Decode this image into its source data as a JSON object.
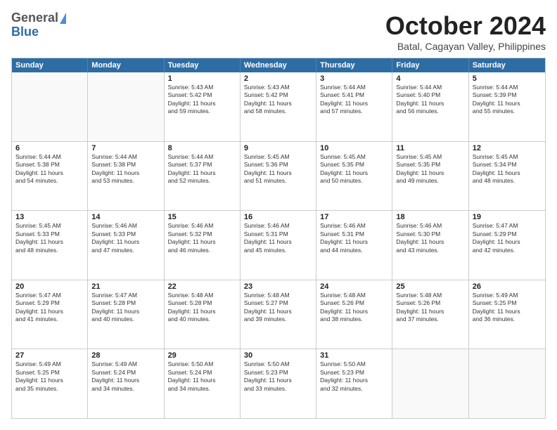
{
  "logo": {
    "general": "General",
    "blue": "Blue"
  },
  "header": {
    "month": "October 2024",
    "location": "Batal, Cagayan Valley, Philippines"
  },
  "weekdays": [
    "Sunday",
    "Monday",
    "Tuesday",
    "Wednesday",
    "Thursday",
    "Friday",
    "Saturday"
  ],
  "rows": [
    [
      {
        "day": "",
        "empty": true
      },
      {
        "day": "",
        "empty": true
      },
      {
        "day": "1",
        "sunrise": "5:43 AM",
        "sunset": "5:42 PM",
        "daylight": "11 hours and 59 minutes."
      },
      {
        "day": "2",
        "sunrise": "5:43 AM",
        "sunset": "5:42 PM",
        "daylight": "11 hours and 58 minutes."
      },
      {
        "day": "3",
        "sunrise": "5:44 AM",
        "sunset": "5:41 PM",
        "daylight": "11 hours and 57 minutes."
      },
      {
        "day": "4",
        "sunrise": "5:44 AM",
        "sunset": "5:40 PM",
        "daylight": "11 hours and 56 minutes."
      },
      {
        "day": "5",
        "sunrise": "5:44 AM",
        "sunset": "5:39 PM",
        "daylight": "11 hours and 55 minutes."
      }
    ],
    [
      {
        "day": "6",
        "sunrise": "5:44 AM",
        "sunset": "5:38 PM",
        "daylight": "11 hours and 54 minutes."
      },
      {
        "day": "7",
        "sunrise": "5:44 AM",
        "sunset": "5:38 PM",
        "daylight": "11 hours and 53 minutes."
      },
      {
        "day": "8",
        "sunrise": "5:44 AM",
        "sunset": "5:37 PM",
        "daylight": "11 hours and 52 minutes."
      },
      {
        "day": "9",
        "sunrise": "5:45 AM",
        "sunset": "5:36 PM",
        "daylight": "11 hours and 51 minutes."
      },
      {
        "day": "10",
        "sunrise": "5:45 AM",
        "sunset": "5:35 PM",
        "daylight": "11 hours and 50 minutes."
      },
      {
        "day": "11",
        "sunrise": "5:45 AM",
        "sunset": "5:35 PM",
        "daylight": "11 hours and 49 minutes."
      },
      {
        "day": "12",
        "sunrise": "5:45 AM",
        "sunset": "5:34 PM",
        "daylight": "11 hours and 48 minutes."
      }
    ],
    [
      {
        "day": "13",
        "sunrise": "5:45 AM",
        "sunset": "5:33 PM",
        "daylight": "11 hours and 48 minutes."
      },
      {
        "day": "14",
        "sunrise": "5:46 AM",
        "sunset": "5:33 PM",
        "daylight": "11 hours and 47 minutes."
      },
      {
        "day": "15",
        "sunrise": "5:46 AM",
        "sunset": "5:32 PM",
        "daylight": "11 hours and 46 minutes."
      },
      {
        "day": "16",
        "sunrise": "5:46 AM",
        "sunset": "5:31 PM",
        "daylight": "11 hours and 45 minutes."
      },
      {
        "day": "17",
        "sunrise": "5:46 AM",
        "sunset": "5:31 PM",
        "daylight": "11 hours and 44 minutes."
      },
      {
        "day": "18",
        "sunrise": "5:46 AM",
        "sunset": "5:30 PM",
        "daylight": "11 hours and 43 minutes."
      },
      {
        "day": "19",
        "sunrise": "5:47 AM",
        "sunset": "5:29 PM",
        "daylight": "11 hours and 42 minutes."
      }
    ],
    [
      {
        "day": "20",
        "sunrise": "5:47 AM",
        "sunset": "5:29 PM",
        "daylight": "11 hours and 41 minutes."
      },
      {
        "day": "21",
        "sunrise": "5:47 AM",
        "sunset": "5:28 PM",
        "daylight": "11 hours and 40 minutes."
      },
      {
        "day": "22",
        "sunrise": "5:48 AM",
        "sunset": "5:28 PM",
        "daylight": "11 hours and 40 minutes."
      },
      {
        "day": "23",
        "sunrise": "5:48 AM",
        "sunset": "5:27 PM",
        "daylight": "11 hours and 39 minutes."
      },
      {
        "day": "24",
        "sunrise": "5:48 AM",
        "sunset": "5:26 PM",
        "daylight": "11 hours and 38 minutes."
      },
      {
        "day": "25",
        "sunrise": "5:48 AM",
        "sunset": "5:26 PM",
        "daylight": "11 hours and 37 minutes."
      },
      {
        "day": "26",
        "sunrise": "5:49 AM",
        "sunset": "5:25 PM",
        "daylight": "11 hours and 36 minutes."
      }
    ],
    [
      {
        "day": "27",
        "sunrise": "5:49 AM",
        "sunset": "5:25 PM",
        "daylight": "11 hours and 35 minutes."
      },
      {
        "day": "28",
        "sunrise": "5:49 AM",
        "sunset": "5:24 PM",
        "daylight": "11 hours and 34 minutes."
      },
      {
        "day": "29",
        "sunrise": "5:50 AM",
        "sunset": "5:24 PM",
        "daylight": "11 hours and 34 minutes."
      },
      {
        "day": "30",
        "sunrise": "5:50 AM",
        "sunset": "5:23 PM",
        "daylight": "11 hours and 33 minutes."
      },
      {
        "day": "31",
        "sunrise": "5:50 AM",
        "sunset": "5:23 PM",
        "daylight": "11 hours and 32 minutes."
      },
      {
        "day": "",
        "empty": true
      },
      {
        "day": "",
        "empty": true
      }
    ]
  ],
  "labels": {
    "sunrise": "Sunrise:",
    "sunset": "Sunset:",
    "daylight": "Daylight: "
  }
}
